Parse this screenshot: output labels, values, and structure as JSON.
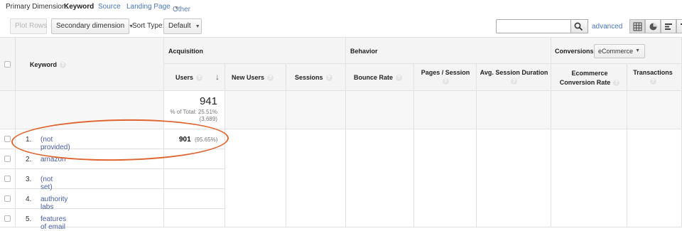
{
  "dimension_bar": {
    "label": "Primary Dimension:",
    "active": "Keyword",
    "options": [
      "Source",
      "Landing Page",
      "Other"
    ]
  },
  "toolbar": {
    "plot_rows": "Plot Rows",
    "secondary_dimension": "Secondary dimension",
    "sort_type_label": "Sort Type:",
    "sort_type_value": "Default",
    "search_placeholder": "",
    "advanced": "advanced",
    "view_icons": [
      "table-view-icon",
      "pie-view-icon",
      "performance-view-icon",
      "comparison-view-icon"
    ]
  },
  "table": {
    "keyword_header": "Keyword",
    "groups": {
      "acquisition": "Acquisition",
      "behavior": "Behavior",
      "conversions": "Conversions",
      "conversions_select": "eCommerce"
    },
    "columns": [
      "Users",
      "New Users",
      "Sessions",
      "Bounce Rate",
      "Pages / Session",
      "Avg. Session Duration",
      "Ecommerce Conversion Rate",
      "Transactions"
    ],
    "totals": {
      "users": "941",
      "pct_of_total": "% of Total: 25.51%",
      "grand_total": "(3,689)"
    },
    "rows": [
      {
        "num": "1.",
        "keyword": "(not provided)",
        "users": "901",
        "users_pct": "(95.65%)"
      },
      {
        "num": "2.",
        "keyword": "amazon"
      },
      {
        "num": "3.",
        "keyword": "(not set)"
      },
      {
        "num": "4.",
        "keyword": "authority labs"
      },
      {
        "num": "5.",
        "keyword": "features of email"
      }
    ]
  },
  "colors": {
    "highlight_oval": "#e0642f",
    "link": "#4a76b9"
  }
}
